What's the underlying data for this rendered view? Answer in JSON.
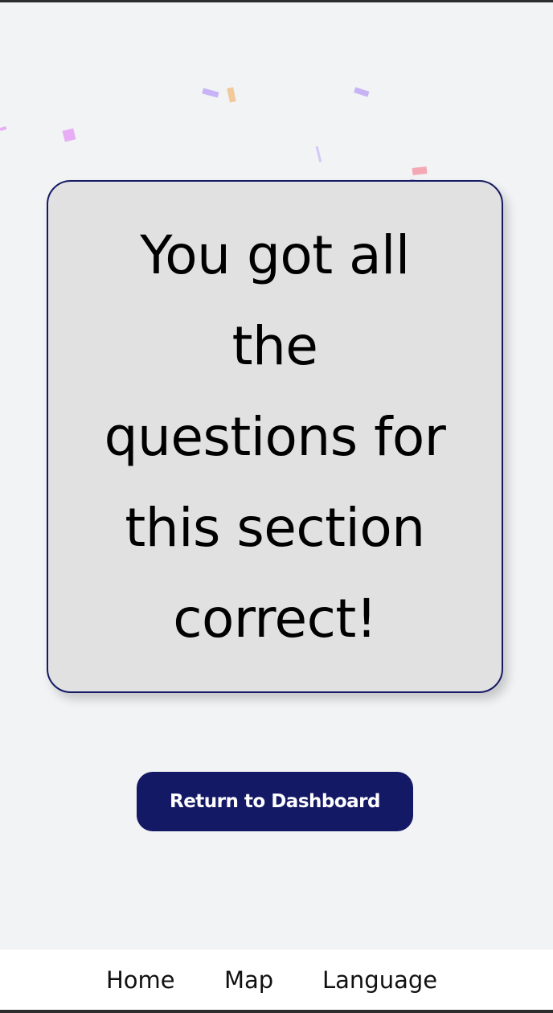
{
  "message": {
    "lines": [
      "You got all",
      "the",
      "questions for",
      "this section",
      "correct!"
    ]
  },
  "actions": {
    "return_label": "Return to Dashboard"
  },
  "bottom_nav": {
    "items": [
      {
        "label": "Home"
      },
      {
        "label": "Map"
      },
      {
        "label": "Language"
      }
    ]
  },
  "colors": {
    "background": "#f2f3f5",
    "card_fill": "#e1e1e2",
    "card_border": "#151a63",
    "button_fill": "#141966",
    "button_text": "#ffffff",
    "nav_background": "#ffffff"
  },
  "decorations": {
    "confetti_colors": [
      "#c7b3f5",
      "#f2c99a",
      "#e8aef5",
      "#d5c8f7",
      "#f4a8b4",
      "#b9a6ef"
    ]
  }
}
